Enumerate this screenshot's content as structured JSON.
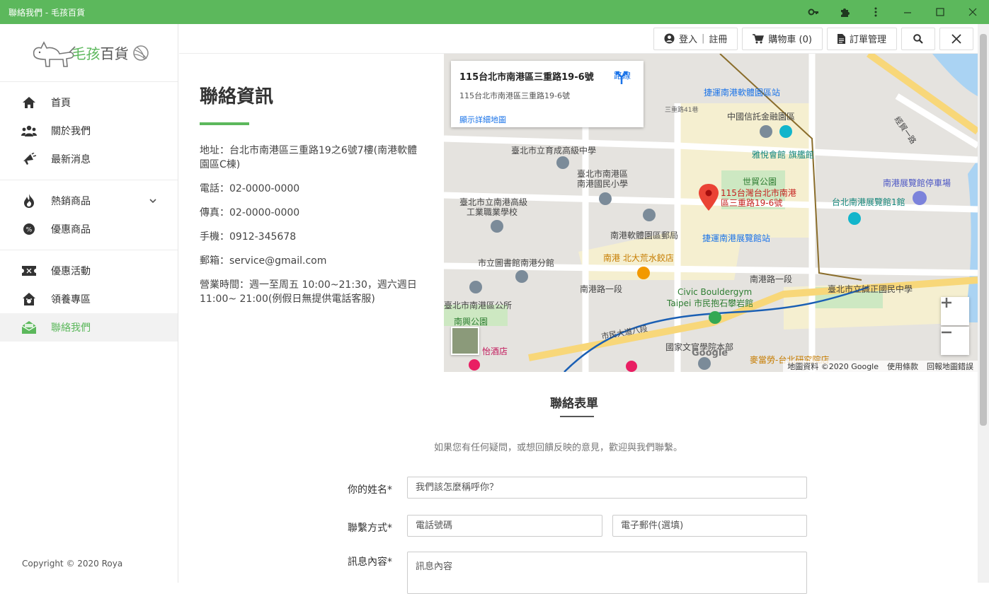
{
  "window": {
    "title": "聯絡我們 - 毛孩百貨"
  },
  "logo": {
    "brand_part1": "毛孩",
    "brand_part2": "百貨"
  },
  "sidebar": {
    "groups": [
      [
        {
          "label": "首頁",
          "icon": "home-icon"
        },
        {
          "label": "關於我們",
          "icon": "users-icon"
        },
        {
          "label": "最新消息",
          "icon": "bullhorn-icon"
        }
      ],
      [
        {
          "label": "熱銷商品",
          "icon": "fire-icon"
        },
        {
          "label": "優惠商品",
          "icon": "percent-icon"
        }
      ],
      [
        {
          "label": "優惠活動",
          "icon": "ticket-icon"
        },
        {
          "label": "領養專區",
          "icon": "pet-house-icon"
        },
        {
          "label": "聯絡我們",
          "icon": "envelope-open-icon"
        }
      ]
    ],
    "copyright": "Copyright © 2020 Roya"
  },
  "topbar": {
    "login": "登入",
    "sep": "|",
    "register": "註冊",
    "cart": "購物車 (0)",
    "orders": "訂單管理"
  },
  "info": {
    "title": "聯絡資訊",
    "address": "地址：台北市南港區三重路19之6號7樓(南港軟體園區C棟)",
    "phone": "電話：02-0000-0000",
    "fax": "傳真：02-0000-0000",
    "mobile": "手機：0912-345678",
    "email": "郵箱：service@gmail.com",
    "hours": "營業時間：週一至周五 10:00~21:30，週六週日 11:00~ 21:00(例假日無提供電話客服)"
  },
  "map": {
    "card_title": "115台北市南港區三重路19-6號",
    "card_sub": "115台北市南港區三重路19-6號",
    "detail_link": "顯示詳細地圖",
    "route": "路線",
    "pin_label_1": "115台灣台北市南港",
    "pin_label_2": "區三重路19-6號",
    "labels": {
      "l1": "捷運南港軟體園區站",
      "l2": "中國信託金融園區",
      "l3": "雅悅會館 旗艦館",
      "l4": "臺北市立育成高級中學",
      "l5": "臺北市南港區",
      "l6": "南港國民小學",
      "l7": "世貿公園",
      "l8": "臺北市立南港高級",
      "l9": "工業職業學校",
      "l10": "南港展覽館停車場",
      "l11": "台北南港展覽館1館",
      "l12": "南港軟體園區郵局",
      "l13": "捷運南港展覽館站",
      "l14": "南港 北大荒水餃店",
      "l15": "市立圖書館南港分館",
      "l16": "南港路一段",
      "l17": "臺北市立誠正國民中學",
      "l18": "Civic Bouldergym",
      "l19": "Taipei 市民抱石攀岩館",
      "l20": "臺北市南港區公所",
      "l21": "南興公園",
      "l22": "國家文官學院本部",
      "l23": "麥當勞-台北研究院店",
      "l24": "經貿一路",
      "l25": "三重路41巷",
      "l26": "市民大道八段",
      "l27": "南港路一段",
      "l28": "怡酒店"
    },
    "footer": {
      "data": "地圖資料 ©2020 Google",
      "terms": "使用條款",
      "report": "回報地圖錯誤"
    },
    "google": "Google"
  },
  "form": {
    "title": "聯絡表單",
    "desc": "如果您有任何疑問，或想回饋反映的意見，歡迎與我們聯繫。",
    "name_label": "你的姓名*",
    "name_placeholder": "我們該怎麼稱呼你？",
    "contact_label": "聯繫方式*",
    "phone_placeholder": "電話號碼",
    "email_placeholder": "電子郵件(選填)",
    "message_label": "訊息內容*",
    "message_placeholder": "訊息內容"
  }
}
